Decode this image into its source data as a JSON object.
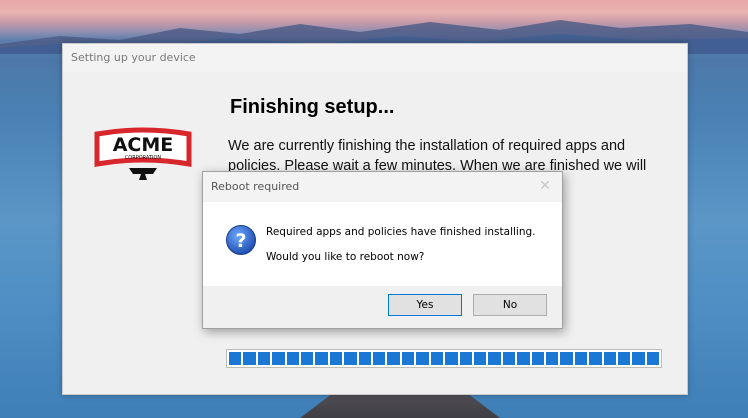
{
  "setup": {
    "title": "Setting up your device",
    "heading": "Finishing setup...",
    "body": "We are currently finishing the installation of required apps and policies. Please wait a few minutes. When we are finished we will",
    "progress_percent": 100
  },
  "logo": {
    "text": "ACME",
    "subtext": "CORPORATION"
  },
  "dialog": {
    "title": "Reboot required",
    "close_glyph": "✕",
    "message_line1": "Required apps and policies have finished installing.",
    "message_line2": "Would you like to reboot now?",
    "yes_label": "Yes",
    "no_label": "No",
    "icon_glyph": "?"
  },
  "colors": {
    "progress_fill": "#1a78d4",
    "logo_red": "#d8262d",
    "icon_blue": "#1f5fc4"
  }
}
